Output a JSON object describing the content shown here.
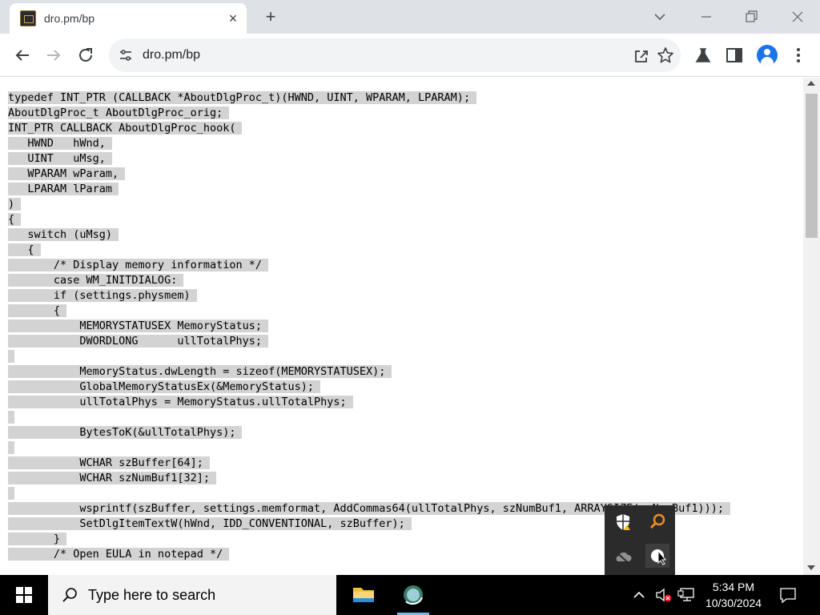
{
  "tab": {
    "title": "dro.pm/bp"
  },
  "address": {
    "url": "dro.pm/bp"
  },
  "code_lines": [
    "typedef INT_PTR (CALLBACK *AboutDlgProc_t)(HWND, UINT, WPARAM, LPARAM);",
    "AboutDlgProc_t AboutDlgProc_orig;",
    "INT_PTR CALLBACK AboutDlgProc_hook(",
    "   HWND   hWnd,",
    "   UINT   uMsg,",
    "   WPARAM wParam,",
    "   LPARAM lParam",
    ")",
    "{",
    "   switch (uMsg)",
    "   {",
    "       /* Display memory information */",
    "       case WM_INITDIALOG:",
    "       if (settings.physmem)",
    "       {",
    "           MEMORYSTATUSEX MemoryStatus;",
    "           DWORDLONG      ullTotalPhys;",
    "",
    "           MemoryStatus.dwLength = sizeof(MEMORYSTATUSEX);",
    "           GlobalMemoryStatusEx(&MemoryStatus);",
    "           ullTotalPhys = MemoryStatus.ullTotalPhys;",
    "",
    "           BytesToK(&ullTotalPhys);",
    "",
    "           WCHAR szBuffer[64];",
    "           WCHAR szNumBuf1[32];",
    "",
    "           wsprintf(szBuffer, settings.memformat, AddCommas64(ullTotalPhys, szNumBuf1, ARRAYSIZE(szNumBuf1)));",
    "           SetDlgItemTextW(hWnd, IDD_CONVENTIONAL, szBuffer);",
    "       }",
    "       /* Open EULA in notepad */"
  ],
  "taskbar": {
    "search_placeholder": "Type here to search",
    "time": "5:34 PM",
    "date": "10/30/2024"
  },
  "colors": {
    "selection": "#d3d3d3",
    "tab_strip": "#dee1e6",
    "omnibox": "#f1f3f4"
  }
}
